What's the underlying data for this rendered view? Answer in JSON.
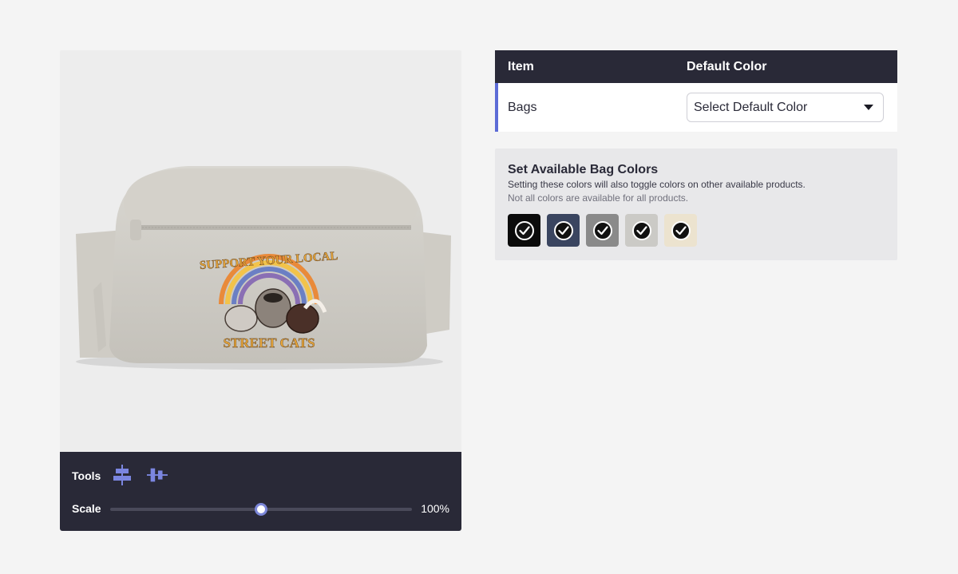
{
  "preview": {
    "product": "Belt bag",
    "artwork_text_top": "SUPPORT YOUR LOCAL",
    "artwork_text_bottom": "STREET CATS"
  },
  "toolbar": {
    "tools_label": "Tools",
    "scale_label": "Scale",
    "scale_value": "100%",
    "scale_fraction": 0.5,
    "tools": [
      "align-center-icon",
      "distribute-icon"
    ]
  },
  "table": {
    "headers": {
      "item": "Item",
      "default_color": "Default Color"
    },
    "rows": [
      {
        "item": "Bags",
        "select_placeholder": "Select Default Color"
      }
    ]
  },
  "colors_panel": {
    "title": "Set Available Bag Colors",
    "subtitle": "Setting these colors will also toggle colors on other available products.",
    "note": "Not all colors are available for all products.",
    "swatches": [
      {
        "color": "#0b0b0b",
        "selected": true
      },
      {
        "color": "#3a4560",
        "selected": true
      },
      {
        "color": "#8a8a8a",
        "selected": true
      },
      {
        "color": "#cbcac6",
        "selected": true
      },
      {
        "color": "#ece3cf",
        "selected": true
      }
    ]
  },
  "accent_color": "#5c6bd6",
  "dark_color": "#292937"
}
